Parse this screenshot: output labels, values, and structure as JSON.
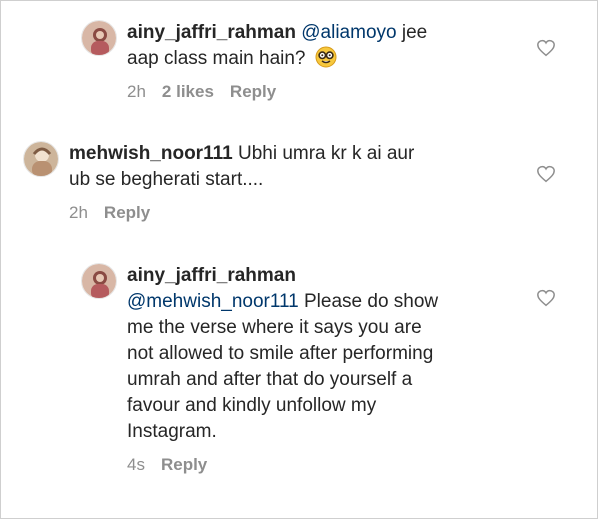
{
  "comments": [
    {
      "username": "ainy_jaffri_rahman",
      "mention": "@aliamoyo",
      "text_line1_rest": " jee",
      "text_line2": "aap class main hain?",
      "emoji": "nerd-face-emoji",
      "time": "2h",
      "likes": "2 likes",
      "reply": "Reply"
    },
    {
      "username": "mehwish_noor111",
      "text_line1_rest": " Ubhi umra kr k ai aur",
      "text_line2": "ub se begherati start....",
      "time": "2h",
      "reply": "Reply"
    },
    {
      "username": "ainy_jaffri_rahman",
      "mention": "@mehwish_noor111",
      "lines": [
        " Please do show",
        "me the verse where it says you are",
        "not allowed to smile after performing",
        "umrah and after that do yourself a",
        "favour and kindly unfollow my",
        "Instagram."
      ],
      "time": "4s",
      "reply": "Reply"
    }
  ],
  "icons": {
    "like": "heart-outline-icon"
  },
  "colors": {
    "text": "#262626",
    "mention": "#00376b",
    "meta": "#8e8e8e"
  }
}
